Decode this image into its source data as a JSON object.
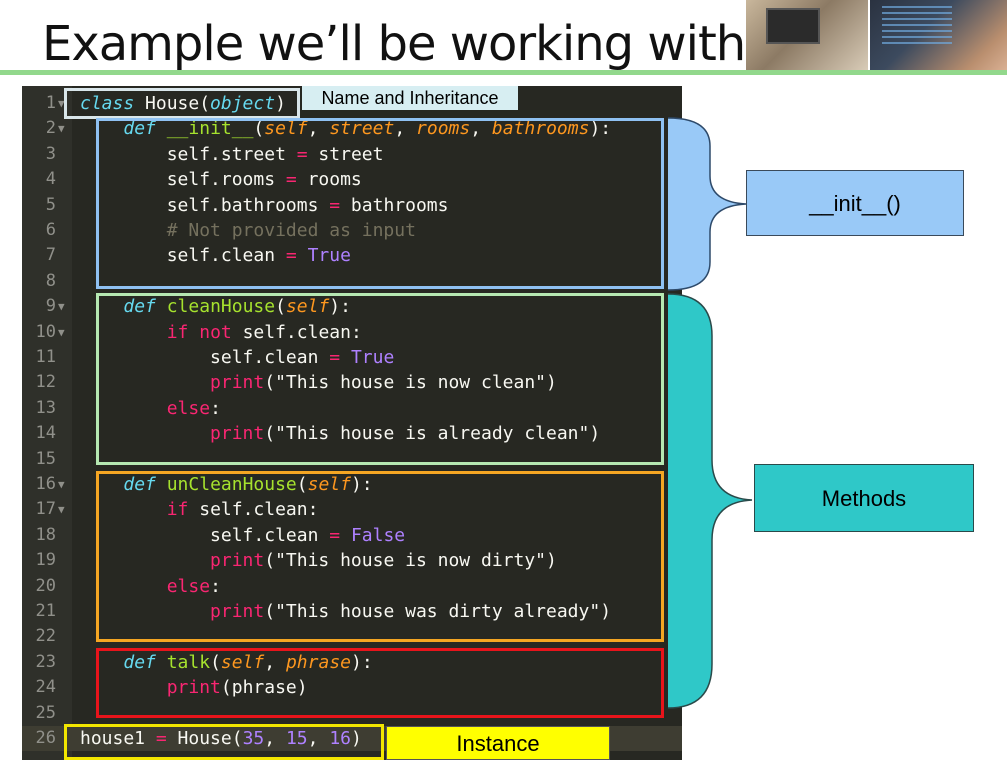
{
  "header": {
    "title": "Example we’ll be working with!"
  },
  "code": {
    "lines": [
      {
        "n": "1",
        "tokens": [
          {
            "t": "class",
            "c": "kw"
          },
          {
            "t": " House(",
            "c": "white"
          },
          {
            "t": "object",
            "c": "kw"
          },
          {
            "t": ")",
            "c": "white"
          }
        ]
      },
      {
        "n": "2",
        "tokens": [
          {
            "t": "    ",
            "c": "white"
          },
          {
            "t": "def",
            "c": "kw"
          },
          {
            "t": " ",
            "c": "white"
          },
          {
            "t": "__init__",
            "c": "green"
          },
          {
            "t": "(",
            "c": "white"
          },
          {
            "t": "self",
            "c": "orange"
          },
          {
            "t": ", ",
            "c": "white"
          },
          {
            "t": "street",
            "c": "orange"
          },
          {
            "t": ", ",
            "c": "white"
          },
          {
            "t": "rooms",
            "c": "orange"
          },
          {
            "t": ", ",
            "c": "white"
          },
          {
            "t": "bathrooms",
            "c": "orange"
          },
          {
            "t": "):",
            "c": "white"
          }
        ]
      },
      {
        "n": "3",
        "tokens": [
          {
            "t": "        self.street ",
            "c": "white"
          },
          {
            "t": "=",
            "c": "pink"
          },
          {
            "t": " street",
            "c": "white"
          }
        ]
      },
      {
        "n": "4",
        "tokens": [
          {
            "t": "        self.rooms ",
            "c": "white"
          },
          {
            "t": "=",
            "c": "pink"
          },
          {
            "t": " rooms",
            "c": "white"
          }
        ]
      },
      {
        "n": "5",
        "tokens": [
          {
            "t": "        self.bathrooms ",
            "c": "white"
          },
          {
            "t": "=",
            "c": "pink"
          },
          {
            "t": " bathrooms",
            "c": "white"
          }
        ]
      },
      {
        "n": "6",
        "tokens": [
          {
            "t": "        # Not provided as input",
            "c": "comment"
          }
        ]
      },
      {
        "n": "7",
        "tokens": [
          {
            "t": "        self.clean ",
            "c": "white"
          },
          {
            "t": "=",
            "c": "pink"
          },
          {
            "t": " ",
            "c": "white"
          },
          {
            "t": "True",
            "c": "purple"
          }
        ]
      },
      {
        "n": "8",
        "tokens": []
      },
      {
        "n": "9",
        "tokens": [
          {
            "t": "    ",
            "c": "white"
          },
          {
            "t": "def",
            "c": "kw"
          },
          {
            "t": " ",
            "c": "white"
          },
          {
            "t": "cleanHouse",
            "c": "green"
          },
          {
            "t": "(",
            "c": "white"
          },
          {
            "t": "self",
            "c": "orange"
          },
          {
            "t": "):",
            "c": "white"
          }
        ]
      },
      {
        "n": "10",
        "tokens": [
          {
            "t": "        ",
            "c": "white"
          },
          {
            "t": "if",
            "c": "pink"
          },
          {
            "t": " ",
            "c": "white"
          },
          {
            "t": "not",
            "c": "pink"
          },
          {
            "t": " self.clean:",
            "c": "white"
          }
        ]
      },
      {
        "n": "11",
        "tokens": [
          {
            "t": "            self.clean ",
            "c": "white"
          },
          {
            "t": "=",
            "c": "pink"
          },
          {
            "t": " ",
            "c": "white"
          },
          {
            "t": "True",
            "c": "purple"
          }
        ]
      },
      {
        "n": "12",
        "tokens": [
          {
            "t": "            ",
            "c": "white"
          },
          {
            "t": "print",
            "c": "pink"
          },
          {
            "t": "(",
            "c": "white"
          },
          {
            "t": "\"This house is now clean\"",
            "c": "white"
          },
          {
            "t": ")",
            "c": "white"
          }
        ]
      },
      {
        "n": "13",
        "tokens": [
          {
            "t": "        ",
            "c": "white"
          },
          {
            "t": "else",
            "c": "pink"
          },
          {
            "t": ":",
            "c": "white"
          }
        ]
      },
      {
        "n": "14",
        "tokens": [
          {
            "t": "            ",
            "c": "white"
          },
          {
            "t": "print",
            "c": "pink"
          },
          {
            "t": "(",
            "c": "white"
          },
          {
            "t": "\"This house is already clean\"",
            "c": "white"
          },
          {
            "t": ")",
            "c": "white"
          }
        ]
      },
      {
        "n": "15",
        "tokens": []
      },
      {
        "n": "16",
        "tokens": [
          {
            "t": "    ",
            "c": "white"
          },
          {
            "t": "def",
            "c": "kw"
          },
          {
            "t": " ",
            "c": "white"
          },
          {
            "t": "unCleanHouse",
            "c": "green"
          },
          {
            "t": "(",
            "c": "white"
          },
          {
            "t": "self",
            "c": "orange"
          },
          {
            "t": "):",
            "c": "white"
          }
        ]
      },
      {
        "n": "17",
        "tokens": [
          {
            "t": "        ",
            "c": "white"
          },
          {
            "t": "if",
            "c": "pink"
          },
          {
            "t": " self.clean:",
            "c": "white"
          }
        ]
      },
      {
        "n": "18",
        "tokens": [
          {
            "t": "            self.clean ",
            "c": "white"
          },
          {
            "t": "=",
            "c": "pink"
          },
          {
            "t": " ",
            "c": "white"
          },
          {
            "t": "False",
            "c": "purple"
          }
        ]
      },
      {
        "n": "19",
        "tokens": [
          {
            "t": "            ",
            "c": "white"
          },
          {
            "t": "print",
            "c": "pink"
          },
          {
            "t": "(",
            "c": "white"
          },
          {
            "t": "\"This house is now dirty\"",
            "c": "white"
          },
          {
            "t": ")",
            "c": "white"
          }
        ]
      },
      {
        "n": "20",
        "tokens": [
          {
            "t": "        ",
            "c": "white"
          },
          {
            "t": "else",
            "c": "pink"
          },
          {
            "t": ":",
            "c": "white"
          }
        ]
      },
      {
        "n": "21",
        "tokens": [
          {
            "t": "            ",
            "c": "white"
          },
          {
            "t": "print",
            "c": "pink"
          },
          {
            "t": "(",
            "c": "white"
          },
          {
            "t": "\"This house was dirty already\"",
            "c": "white"
          },
          {
            "t": ")",
            "c": "white"
          }
        ]
      },
      {
        "n": "22",
        "tokens": []
      },
      {
        "n": "23",
        "tokens": [
          {
            "t": "    ",
            "c": "white"
          },
          {
            "t": "def",
            "c": "kw"
          },
          {
            "t": " ",
            "c": "white"
          },
          {
            "t": "talk",
            "c": "green"
          },
          {
            "t": "(",
            "c": "white"
          },
          {
            "t": "self",
            "c": "orange"
          },
          {
            "t": ", ",
            "c": "white"
          },
          {
            "t": "phrase",
            "c": "orange"
          },
          {
            "t": "):",
            "c": "white"
          }
        ]
      },
      {
        "n": "24",
        "tokens": [
          {
            "t": "        ",
            "c": "white"
          },
          {
            "t": "print",
            "c": "pink"
          },
          {
            "t": "(phrase)",
            "c": "white"
          }
        ]
      },
      {
        "n": "25",
        "tokens": []
      },
      {
        "n": "26",
        "tokens": [
          {
            "t": "house1 ",
            "c": "white"
          },
          {
            "t": "=",
            "c": "pink"
          },
          {
            "t": " House(",
            "c": "white"
          },
          {
            "t": "35",
            "c": "purple"
          },
          {
            "t": ", ",
            "c": "white"
          },
          {
            "t": "15",
            "c": "purple"
          },
          {
            "t": ", ",
            "c": "white"
          },
          {
            "t": "16",
            "c": "purple"
          },
          {
            "t": ")",
            "c": "white"
          }
        ]
      }
    ],
    "foldable_lines": [
      "1",
      "2",
      "9",
      "10",
      "16",
      "17"
    ]
  },
  "annotations": {
    "name_inheritance": "Name and Inheritance",
    "init": "__init__()",
    "methods": "Methods",
    "instance": "Instance"
  },
  "colors": {
    "init_box": "#8fc1f2",
    "init_label_bg": "#99c9f7",
    "clean_box": "#b6e8b2",
    "unclean_box": "#f5a623",
    "talk_box": "#e8141b",
    "methods_label_bg": "#2fc8c8",
    "instance_box": "#f2e600",
    "instance_label_bg": "#ffff00",
    "name_label_bg": "#d7eef2",
    "title_rule": "#92d88c"
  }
}
